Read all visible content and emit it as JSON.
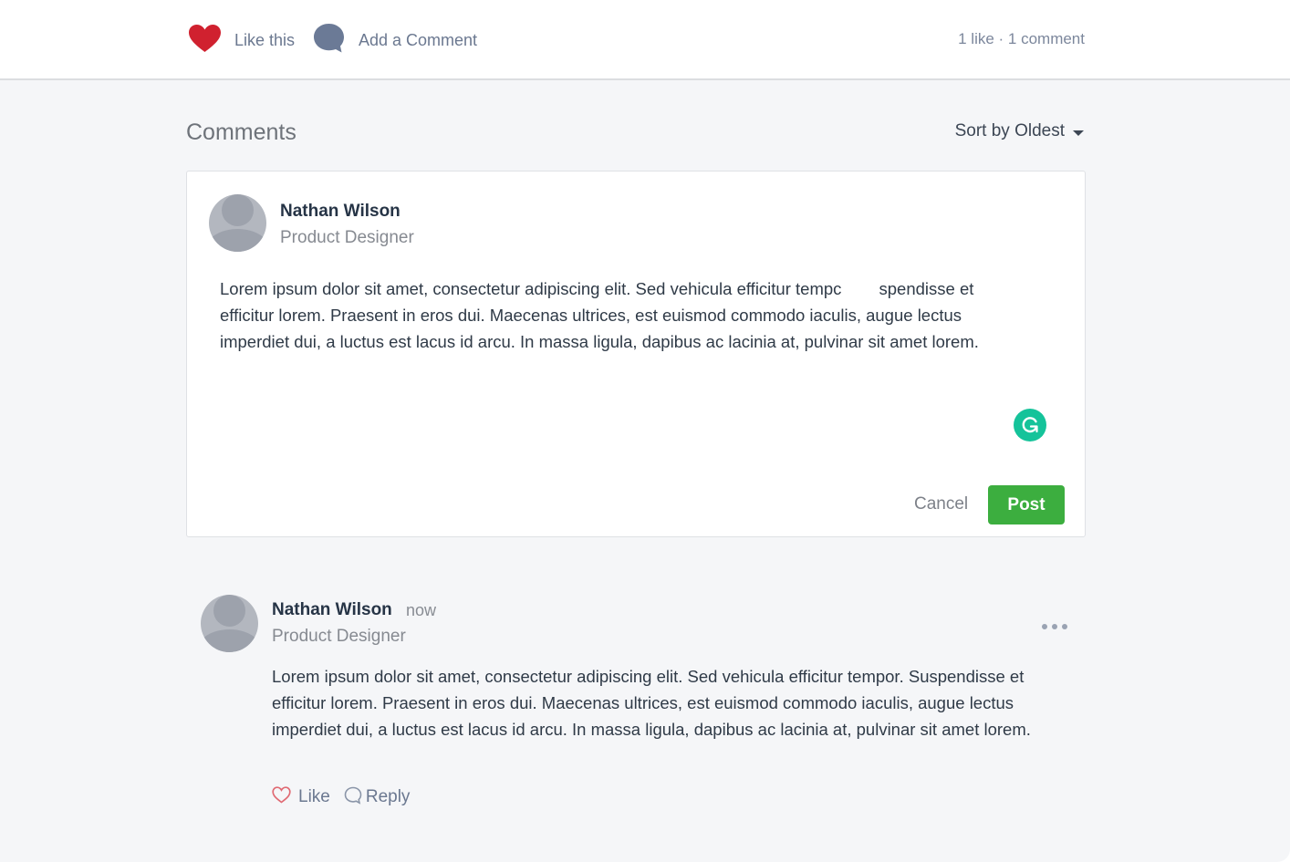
{
  "topbar": {
    "like_label": "Like this",
    "comment_label": "Add a Comment",
    "counts": "1 like · 1 comment",
    "like_icon": "heart-filled-icon",
    "comment_icon": "speech-bubble-filled-icon"
  },
  "comments_section": {
    "title": "Comments",
    "sort_label": "Sort by Oldest",
    "sort_icon": "caret-down-icon"
  },
  "editor": {
    "author_name": "Nathan Wilson",
    "author_role": "Product Designer",
    "text": "Lorem ipsum dolor sit amet, consectetur adipiscing elit. Sed vehicula efficitur tempc        spendisse et\nefficitur lorem. Praesent in eros dui. Maecenas ultrices, est euismod commodo iaculis, augue lectus\nimperdiet dui, a luctus est lacus id arcu. In massa ligula, dapibus ac lacinia at, pulvinar sit amet lorem.",
    "grammarly_icon": "grammarly-icon",
    "cancel_label": "Cancel",
    "post_label": "Post"
  },
  "comments": [
    {
      "author_name": "Nathan Wilson",
      "time": "now",
      "author_role": "Product Designer",
      "text": "Lorem ipsum dolor sit amet, consectetur adipiscing elit. Sed vehicula efficitur tempor. Suspendisse et efficitur lorem. Praesent in eros dui. Maecenas ultrices, est euismod commodo iaculis, augue lectus imperdiet dui, a luctus est lacus id arcu. In massa ligula, dapibus ac lacinia at, pulvinar sit amet lorem.",
      "like_label": "Like",
      "reply_label": "Reply",
      "more_icon": "more-horizontal-icon"
    }
  ],
  "colors": {
    "heart": "#d0212f",
    "bubble": "#6b7a96",
    "post_button": "#3cae3f",
    "grammarly": "#15c39a",
    "page_bg": "#f5f6f8"
  }
}
